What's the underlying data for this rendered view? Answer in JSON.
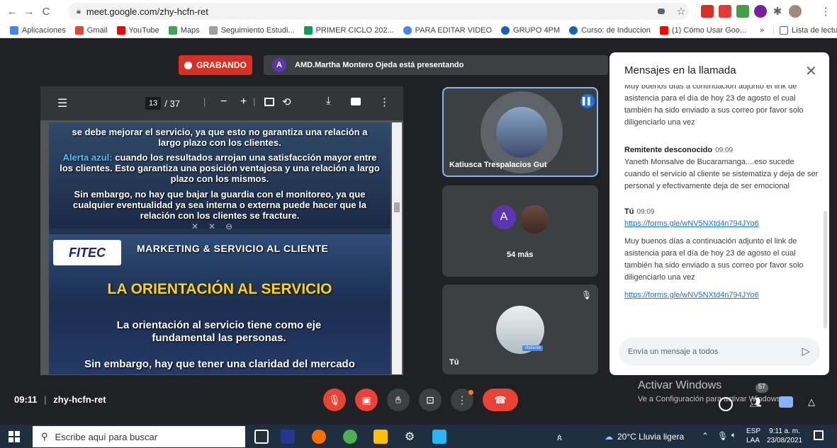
{
  "browser": {
    "url": "meet.google.com/zhy-hcfn-ret"
  },
  "bookmarks": {
    "items": [
      "Aplicaciones",
      "Gmail",
      "YouTube",
      "Maps",
      "Seguimiento Estudi...",
      "PRIMER CICLO 202...",
      "PARA EDITAR VIDEO",
      "GRUPO 4PM",
      "Curso: de Induccion",
      "(1) Cómo Usar Goo..."
    ],
    "more": "»",
    "reading_list": "Lista de lectura"
  },
  "meet": {
    "recording_label": "GRABANDO",
    "presenter_avatar": "A",
    "presenter_text": "AMD.Martha Montero Ojeda está presentando",
    "pdf": {
      "page": "13",
      "total": "/ 37"
    },
    "slide1": {
      "line1": "se debe mejorar el servicio, ya que esto no garantiza una relación a largo plazo con los clientes.",
      "alert_label": "Alerta azul:",
      "line2": " cuando los resultados arrojan una satisfacción mayor entre los clientes. Esto garantiza una posición ventajosa y una relación a largo plazo con los mismos.",
      "line3": "Sin embargo, no hay que bajar la guardia con el monitoreo, ya que cualquier eventualidad ya sea interna o externa puede hacer que la relación con los clientes se fracture."
    },
    "slide2": {
      "logo": "FITEC",
      "header": "MARKETING & SERVICIO AL CLIENTE",
      "title": "LA ORIENTACIÓN AL SERVICIO",
      "body1": "La orientación al servicio tiene como eje fundamental las personas.",
      "body2": "Sin embargo, hay que tener una claridad del mercado"
    },
    "tiles": {
      "tile1_name": "Katiusca Trespalacios Gut",
      "tile2_avatar": "A",
      "tile2_more": "54 más",
      "tile3_name": "Tú",
      "tile3_badge": "Visitante"
    },
    "chat": {
      "title": "Mensajes en la llamada",
      "messages": [
        {
          "sender": "",
          "time": "",
          "text": "Muy buenos días a continuación adjunto el link de asistencia para el día de hoy 23 de agosto el cual también ha sido enviado a sus correo por favor solo diligenciarlo una vez"
        },
        {
          "sender": "Remitente desconocido",
          "time": "09:09",
          "text": "Yaneth Monsalve de Bucaramanga....eso sucede cuando el servicio al cliente se sistematiza y deja de ser personal y efectivamente deja de ser emocional"
        },
        {
          "sender": "Tú",
          "time": "09:09",
          "link1": "https://forms.gle/wNV5NXtd4n794JYo6",
          "text": "Muy buenos días a continuación adjunto el link de asistencia para el día de hoy 23 de agosto el cual también ha sido enviado a sus correo por favor solo diligenciarlo una vez",
          "link2": "https://forms.gle/wNV5NXtd4n794JYo6"
        }
      ],
      "input_placeholder": "Envía un mensaje a todos"
    },
    "bottom": {
      "time": "09:11",
      "separator": "|",
      "code": "zhy-hcfn-ret",
      "participants_count": "57"
    }
  },
  "watermark": {
    "line1": "Activar Windows",
    "line2": "Ve a Configuración para activar Windows."
  },
  "taskbar": {
    "search_placeholder": "Escribe aquí para buscar",
    "weather": "20°C Lluvia ligera",
    "lang1": "ESP",
    "lang2": "LAA",
    "time": "9:11 a. m.",
    "date": "23/08/2021"
  },
  "colors": {
    "record": "#d93025",
    "meet_bg": "#202124",
    "tile_bg": "#3c4043",
    "link": "#1a73e8",
    "end_call": "#ea4335",
    "slide_title": "#ffd600",
    "alert_blue": "#4fc3f7"
  }
}
